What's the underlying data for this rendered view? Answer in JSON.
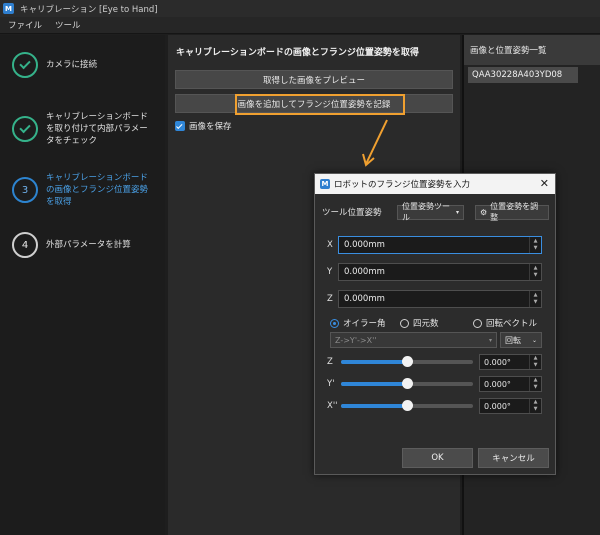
{
  "window": {
    "title": "キャリブレーション [Eye to Hand]",
    "icon_text": "M"
  },
  "menu": [
    "ファイル",
    "ツール"
  ],
  "steps": [
    {
      "label": "カメラに接続",
      "state": "done"
    },
    {
      "label": "キャリブレーションボードを取り付けて内部パラメータをチェック",
      "state": "done"
    },
    {
      "label": "キャリブレーションボードの画像とフランジ位置姿勢を取得",
      "state": "active",
      "number": "3"
    },
    {
      "label": "外部パラメータを計算",
      "state": "todo",
      "number": "4"
    }
  ],
  "middle": {
    "title": "キャリブレーションボードの画像とフランジ位置姿勢を取得",
    "preview_button": "取得した画像をプレビュー",
    "add_button": "画像を追加してフランジ位置姿勢を記録",
    "save_images_label": "画像を保存",
    "save_images_checked": true
  },
  "right_panel": {
    "header": "画像と位置姿勢一覧",
    "items": [
      "QAA30228A403YD08"
    ]
  },
  "dialog": {
    "title": "ロボットのフランジ位置姿勢を入力",
    "tool_pose_label": "ツール位置姿勢",
    "tool_pose_dropdown": "位置姿勢ツール",
    "adjust_pose_button": "位置姿勢を調整",
    "position": [
      {
        "axis": "X",
        "value": "0.000mm"
      },
      {
        "axis": "Y",
        "value": "0.000mm"
      },
      {
        "axis": "Z",
        "value": "0.000mm"
      }
    ],
    "rotation_modes": [
      "オイラー角",
      "四元数",
      "回転ベクトル"
    ],
    "rotation_selected": "オイラー角",
    "euler_order": "Z->Y'->X''",
    "rotate_button": "回転",
    "angles": [
      {
        "axis": "Z",
        "value": "0.000°",
        "fraction": 0.5
      },
      {
        "axis": "Y'",
        "value": "0.000°",
        "fraction": 0.5
      },
      {
        "axis": "X''",
        "value": "0.000°",
        "fraction": 0.5
      }
    ],
    "ok": "OK",
    "cancel": "キャンセル"
  },
  "colors": {
    "accent": "#2f86d8",
    "done": "#35b28a",
    "highlight": "#f0a030"
  }
}
